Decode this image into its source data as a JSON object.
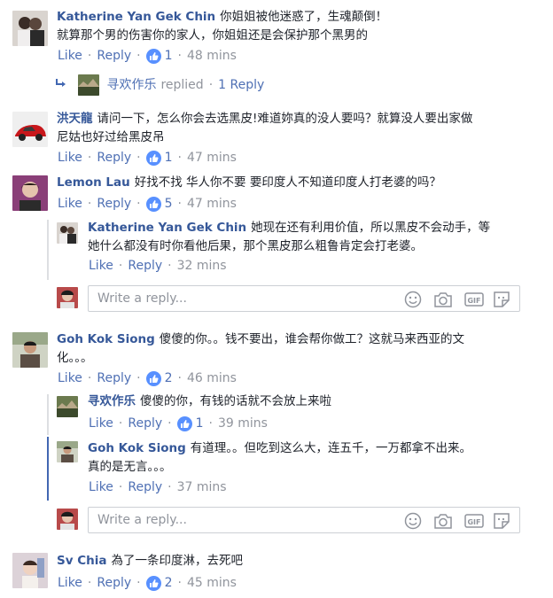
{
  "colors": {
    "author": "#365899",
    "link": "#4f70b4",
    "muted": "#90949c",
    "like_badge": "#5890ff",
    "thread_line": "#dddfe2",
    "thread_line_active": "#4267b2"
  },
  "actions": {
    "like": "Like",
    "reply": "Reply",
    "dot": "·"
  },
  "reply_placeholder": "Write a reply...",
  "comments": [
    {
      "author": "Katherine Yan Gek Chin",
      "lines": [
        "你姐姐被他迷惑了，生魂颠倒！",
        "就算那个男的伤害你的家人，你姐姐还是会保护那个黑男的"
      ],
      "likes": "1",
      "time": "48 mins",
      "replied": {
        "name": "寻欢作乐",
        "text": "replied",
        "count": "1 Reply"
      }
    },
    {
      "author": "洪天龍",
      "lines": [
        "请问一下，怎么你会去选黑皮!难道妳真的没人要吗？就算没人要出家做",
        "尼姑也好过给黑皮吊"
      ],
      "likes": "1",
      "time": "47 mins"
    },
    {
      "author": "Lemon Lau",
      "lines": [
        "好找不找 华人你不要 要印度人不知道印度人打老婆的吗？"
      ],
      "likes": "5",
      "time": "47 mins",
      "replies": [
        {
          "author": "Katherine Yan Gek Chin",
          "lines": [
            "她现在还有利用价值，所以黑皮不会动手，等",
            "她什么都没有时你看他后果，那个黑皮那么粗鲁肯定会打老婆。"
          ],
          "time": "32 mins"
        }
      ]
    },
    {
      "author": "Goh Kok Siong",
      "lines": [
        "傻傻的你。。钱不要出，谁会帮你做工？这就马来西亚的文",
        "化。。。"
      ],
      "likes": "2",
      "time": "46 mins",
      "replies": [
        {
          "author": "寻欢作乐",
          "lines": [
            "傻傻的你，有钱的话就不会放上来啦"
          ],
          "likes": "1",
          "time": "39 mins"
        },
        {
          "author": "Goh Kok Siong",
          "lines": [
            "有道理。。但吃到这么大，连五千，一万都拿不出来。",
            "真的是无言。。。"
          ],
          "time": "37 mins"
        }
      ]
    },
    {
      "author": "Sv Chia",
      "lines": [
        "為了一条印度淋，去死吧"
      ],
      "likes": "2",
      "time": "45 mins"
    }
  ]
}
